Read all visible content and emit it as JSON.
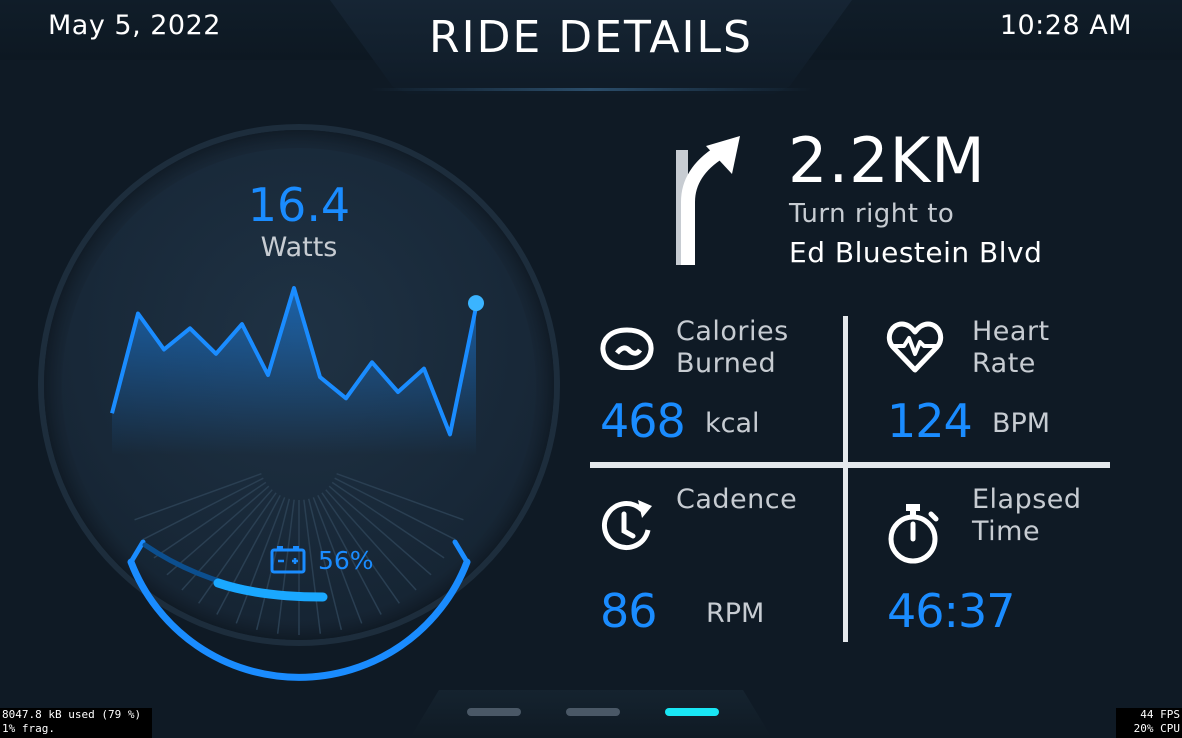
{
  "header": {
    "date": "May 5, 2022",
    "title": "RIDE DETAILS",
    "time": "10:28 AM"
  },
  "power_gauge": {
    "value": "16.4",
    "unit": "Watts",
    "battery_percent_text": "56%",
    "battery_level": 0.56,
    "power_history": [
      0.15,
      0.62,
      0.45,
      0.55,
      0.43,
      0.57,
      0.33,
      0.74,
      0.32,
      0.22,
      0.39,
      0.25,
      0.36,
      0.05,
      0.65
    ],
    "accent_color": "#1a8cff"
  },
  "navigation": {
    "distance": "2.2KM",
    "instruction": "Turn right to",
    "street": "Ed Bluestein Blvd",
    "arrow_icon": "turn-right-arrow"
  },
  "stats": {
    "calories": {
      "label_line1": "Calories",
      "label_line2": "Burned",
      "value": "468",
      "unit": "kcal",
      "icon": "calories-icon"
    },
    "heart_rate": {
      "label_line1": "Heart",
      "label_line2": "Rate",
      "value": "124",
      "unit": "BPM",
      "icon": "heart-rate-icon"
    },
    "cadence": {
      "label_line1": "Cadence",
      "label_line2": "",
      "value": "86",
      "unit": "RPM",
      "icon": "cadence-icon"
    },
    "elapsed": {
      "label_line1": "Elapsed",
      "label_line2": "Time",
      "value": "46:37",
      "unit": "",
      "icon": "stopwatch-icon"
    }
  },
  "pagination": {
    "pages": 3,
    "active_index": 2,
    "active_color": "#19e6f4"
  },
  "debug": {
    "memory_line1": "8047.8 kB used (79 %)",
    "memory_line2": "1% frag.",
    "fps": "44 FPS",
    "cpu": "20% CPU"
  }
}
